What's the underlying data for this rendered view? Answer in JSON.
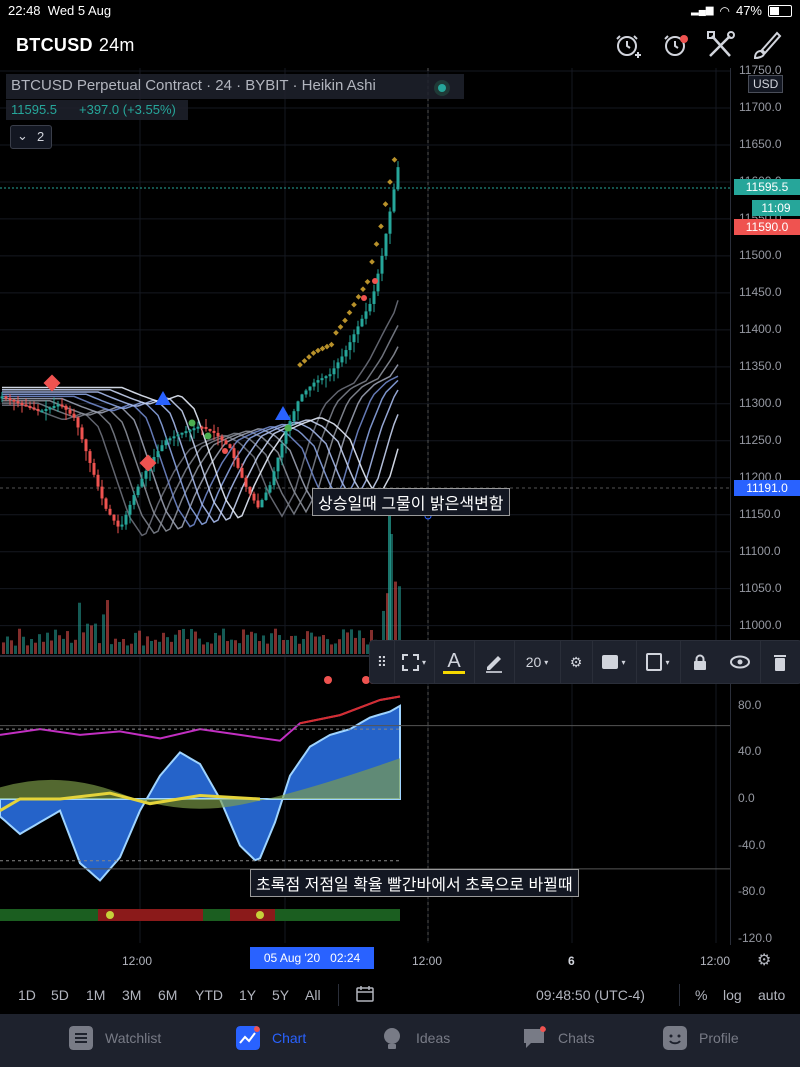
{
  "status_bar": {
    "time": "22:48",
    "date": "Wed 5 Aug",
    "battery": "47%"
  },
  "header": {
    "symbol": "BTCUSD",
    "interval": "24m"
  },
  "legend": {
    "title": "BTCUSD Perpetual Contract · 24 · BYBIT · Heikin Ashi",
    "price": "11595.5",
    "change": "+397.0 (+3.55%)",
    "collapse_count": "2"
  },
  "price_axis": {
    "currency": "USD",
    "ticks": [
      "11750.0",
      "11700.0",
      "11650.0",
      "11600.0",
      "11550.0",
      "11500.0",
      "11450.0",
      "11400.0",
      "11350.0",
      "11300.0",
      "11250.0",
      "11200.0",
      "11150.0",
      "11100.0",
      "11050.0",
      "11000.0"
    ],
    "last_price": "11595.5",
    "countdown": "11:09",
    "bid_price": "11590.0",
    "cursor_price": "11191.0"
  },
  "osc_axis": {
    "ticks": [
      "80.0",
      "40.0",
      "0.0",
      "-40.0",
      "-80.0",
      "-120.0"
    ]
  },
  "toolbar": {
    "font_size": "20"
  },
  "annotations": {
    "note1": "상승일때 그물이 밝은색변함",
    "note2": "초록점 저점일 확율 빨간바에서 초록으로 바뀔때"
  },
  "time_axis": {
    "labels": [
      "12:00",
      "12:00",
      "6",
      "12:00"
    ],
    "cursor_time": "05 Aug '20   02:24"
  },
  "range_bar": {
    "ranges": [
      "1D",
      "5D",
      "1M",
      "3M",
      "6M",
      "YTD",
      "1Y",
      "5Y",
      "All"
    ],
    "clock": "09:48:50 (UTC-4)",
    "percent": "%",
    "log": "log",
    "auto": "auto"
  },
  "tabs": [
    {
      "label": "Watchlist",
      "icon": "watchlist-icon"
    },
    {
      "label": "Chart",
      "icon": "chart-icon"
    },
    {
      "label": "Ideas",
      "icon": "ideas-icon"
    },
    {
      "label": "Chats",
      "icon": "chats-icon"
    },
    {
      "label": "Profile",
      "icon": "profile-icon"
    }
  ],
  "colors": {
    "up": "#26a69a",
    "down": "#ef5350",
    "accent": "#2962ff",
    "background": "#000000"
  }
}
